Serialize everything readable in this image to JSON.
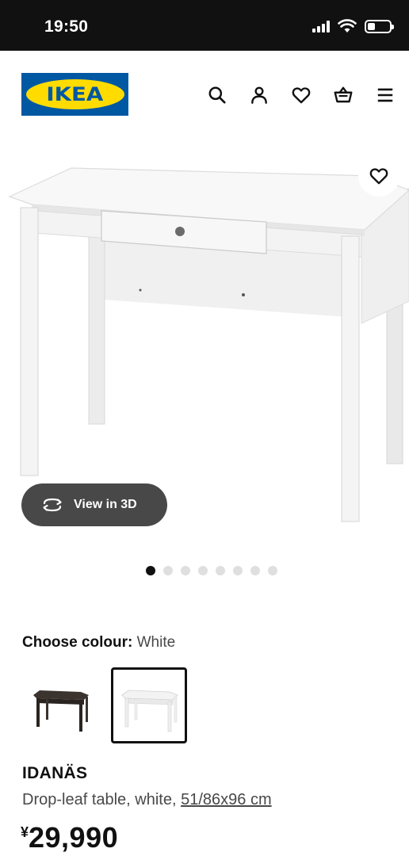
{
  "status_bar": {
    "time": "19:50",
    "icons": [
      "cellular-signal-icon",
      "wifi-icon",
      "battery-icon"
    ]
  },
  "header": {
    "logo_text": "IKEA",
    "icons": [
      "search-icon",
      "account-icon",
      "favourites-icon",
      "shopping-bag-icon",
      "menu-icon"
    ]
  },
  "media": {
    "view_3d_label": "View in 3D",
    "image_count": 8,
    "active_image": 1
  },
  "colour": {
    "label": "Choose colour:",
    "value": "White",
    "options": [
      "black-brown",
      "white"
    ],
    "selected": "white"
  },
  "product": {
    "name": "IDANÄS",
    "description": "Drop-leaf table, white, ",
    "dimensions": "51/86x96 cm",
    "currency": "¥",
    "price": "29,990"
  },
  "colors": {
    "status_bar_bg": "#111111",
    "ikea_blue": "#0058a3",
    "ikea_yellow": "#ffdb00",
    "button_dark": "#484848",
    "inactive_dot": "#dfdfdf"
  }
}
